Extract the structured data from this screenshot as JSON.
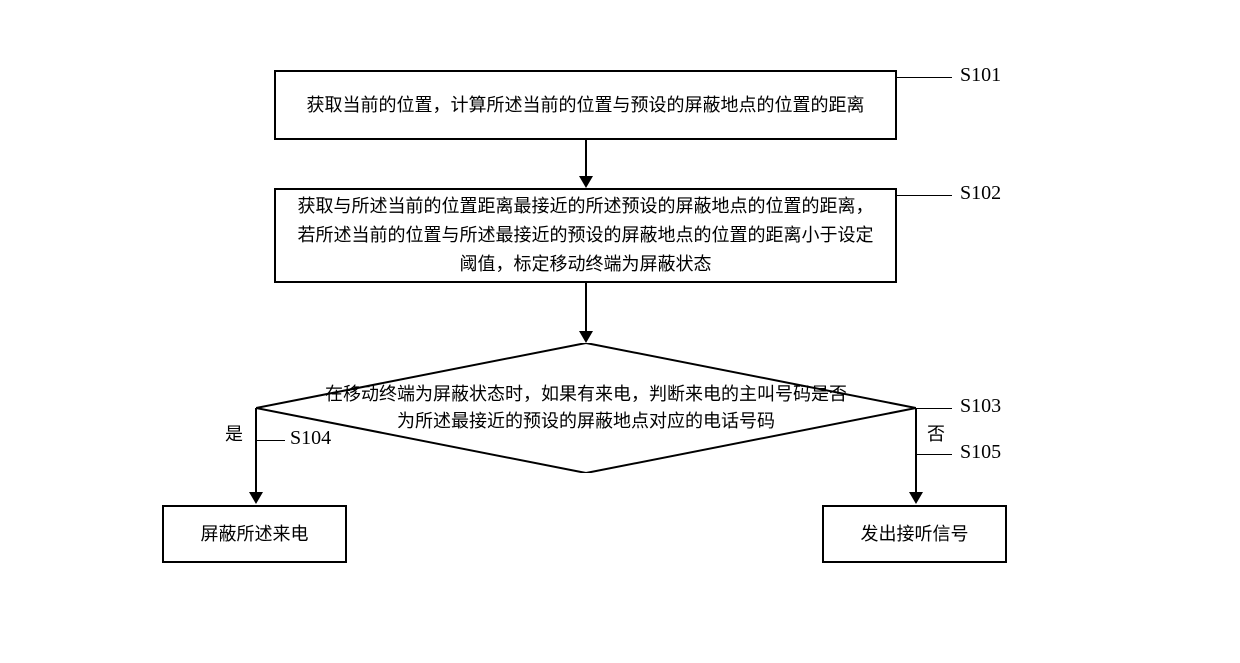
{
  "steps": {
    "s101": {
      "label": "S101",
      "text": "获取当前的位置，计算所述当前的位置与预设的屏蔽地点的位置的距离"
    },
    "s102": {
      "label": "S102",
      "text": "获取与所述当前的位置距离最接近的所述预设的屏蔽地点的位置的距离，若所述当前的位置与所述最接近的预设的屏蔽地点的位置的距离小于设定阈值，标定移动终端为屏蔽状态"
    },
    "s103": {
      "label": "S103",
      "text": "在移动终端为屏蔽状态时，如果有来电，判断来电的主叫号码是否为所述最接近的预设的屏蔽地点对应的电话号码"
    },
    "s104": {
      "label": "S104",
      "text": "屏蔽所述来电"
    },
    "s105": {
      "label": "S105",
      "text": "发出接听信号"
    }
  },
  "branches": {
    "yes": "是",
    "no": "否"
  }
}
